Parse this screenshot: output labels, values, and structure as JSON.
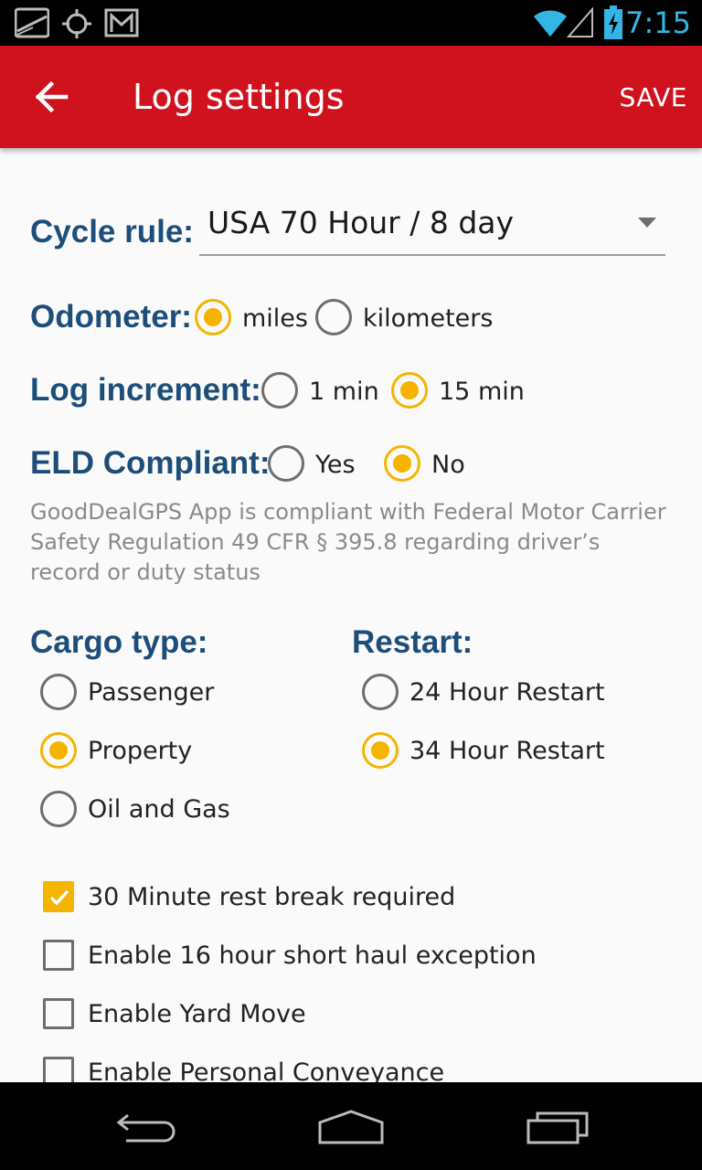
{
  "status_bar": {
    "time": "7:15",
    "left_icons": [
      "road-icon",
      "gps-icon",
      "gmail-icon"
    ],
    "right_icons": [
      "wifi-icon",
      "signal-icon",
      "battery-charging-icon"
    ]
  },
  "app_bar": {
    "title": "Log settings",
    "save_label": "SAVE",
    "color": "#d0121f"
  },
  "cycle_rule": {
    "label": "Cycle rule:",
    "value": "USA 70 Hour / 8 day"
  },
  "odometer": {
    "label": "Odometer:",
    "options": [
      {
        "label": "miles",
        "checked": true
      },
      {
        "label": "kilometers",
        "checked": false
      }
    ]
  },
  "log_increment": {
    "label": "Log increment:",
    "options": [
      {
        "label": "1 min",
        "checked": false
      },
      {
        "label": "15 min",
        "checked": true
      }
    ]
  },
  "eld_compliant": {
    "label": "ELD Compliant:",
    "options": [
      {
        "label": "Yes",
        "checked": false
      },
      {
        "label": "No",
        "checked": true
      }
    ],
    "note": "GoodDealGPS App is compliant with Federal Motor Carrier Safety Regulation 49 CFR § 395.8 regarding driver’s record or duty status"
  },
  "cargo_type": {
    "label": "Cargo type:",
    "options": [
      {
        "label": "Passenger",
        "checked": false
      },
      {
        "label": "Property",
        "checked": true
      },
      {
        "label": "Oil and Gas",
        "checked": false
      }
    ]
  },
  "restart": {
    "label": "Restart:",
    "options": [
      {
        "label": "24 Hour Restart",
        "checked": false
      },
      {
        "label": "34 Hour Restart",
        "checked": true
      }
    ]
  },
  "checkboxes": [
    {
      "label": "30 Minute rest break required",
      "checked": true
    },
    {
      "label": "Enable 16 hour short haul exception",
      "checked": false
    },
    {
      "label": "Enable Yard Move",
      "checked": false
    },
    {
      "label": "Enable Personal Conveyance",
      "checked": false
    }
  ],
  "colors": {
    "accent": "#f5b400",
    "label": "#1d4e7a",
    "toolbar": "#d0121f"
  }
}
